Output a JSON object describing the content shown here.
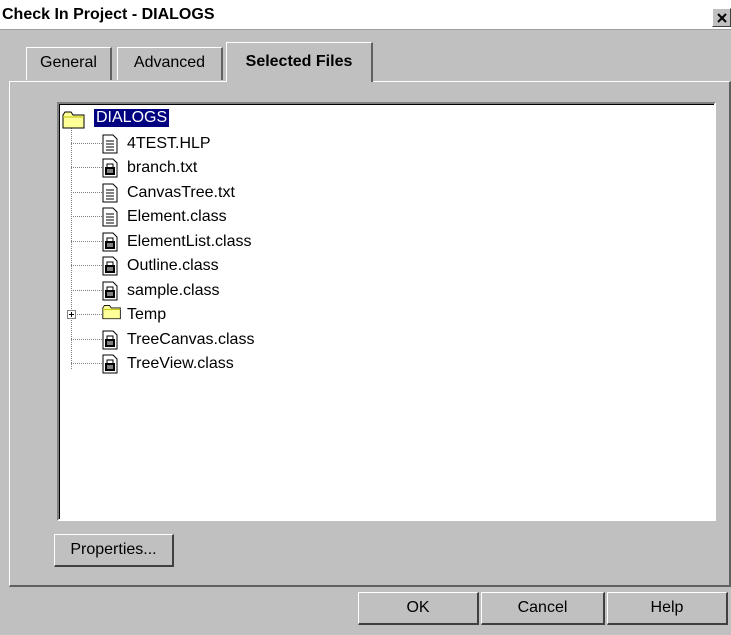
{
  "window": {
    "title": "Check In Project - DIALOGS",
    "close_glyph": "x-icon"
  },
  "tabs": [
    {
      "label": "General",
      "active": false
    },
    {
      "label": "Advanced",
      "active": false
    },
    {
      "label": "Selected Files",
      "active": true
    }
  ],
  "tree": {
    "root": {
      "label": "DIALOGS",
      "icon": "folder-icon",
      "selected": true
    },
    "items": [
      {
        "label": "4TEST.HLP",
        "icon": "document-icon"
      },
      {
        "label": "branch.txt",
        "icon": "locked-document-icon"
      },
      {
        "label": "CanvasTree.txt",
        "icon": "document-icon"
      },
      {
        "label": "Element.class",
        "icon": "document-icon"
      },
      {
        "label": "ElementList.class",
        "icon": "locked-document-icon"
      },
      {
        "label": "Outline.class",
        "icon": "locked-document-icon"
      },
      {
        "label": "sample.class",
        "icon": "locked-document-icon"
      },
      {
        "label": "Temp",
        "icon": "folder-icon",
        "expandable": true
      },
      {
        "label": "TreeCanvas.class",
        "icon": "locked-document-icon"
      },
      {
        "label": "TreeView.class",
        "icon": "locked-document-icon"
      }
    ]
  },
  "buttons": {
    "properties": "Properties...",
    "ok": "OK",
    "cancel": "Cancel",
    "help": "Help"
  },
  "colors": {
    "selection": "#000080",
    "dialog": "#c0c0c0",
    "folder": "#ffff99"
  }
}
